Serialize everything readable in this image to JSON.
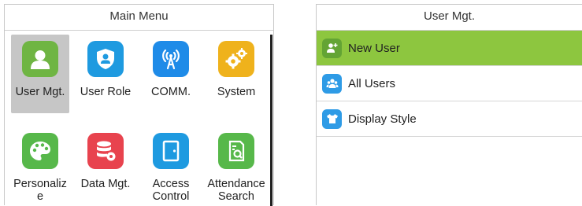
{
  "main_menu": {
    "title": "Main Menu",
    "tiles": [
      {
        "label": "User Mgt.",
        "icon": "user-icon",
        "color": "#6fb543",
        "selected": true
      },
      {
        "label": "User Role",
        "icon": "shield-user-icon",
        "color": "#1e9ae0"
      },
      {
        "label": "COMM.",
        "icon": "antenna-icon",
        "color": "#1e8be8"
      },
      {
        "label": "System",
        "icon": "gears-icon",
        "color": "#efb21c"
      },
      {
        "label": "Personalize",
        "icon": "palette-icon",
        "color": "#57b84a"
      },
      {
        "label": "Data Mgt.",
        "icon": "database-gear-icon",
        "color": "#e8434e"
      },
      {
        "label": "Access Control",
        "icon": "door-icon",
        "color": "#1e9ae0"
      },
      {
        "label": "Attendance Search",
        "icon": "document-search-icon",
        "color": "#57b84a"
      }
    ]
  },
  "user_mgt": {
    "title": "User Mgt.",
    "items": [
      {
        "label": "New User",
        "icon": "add-user-icon",
        "color": "#63a434",
        "selected": true
      },
      {
        "label": "All Users",
        "icon": "users-icon",
        "color": "#2e9be6"
      },
      {
        "label": "Display Style",
        "icon": "shirt-icon",
        "color": "#2e9be6"
      }
    ]
  }
}
